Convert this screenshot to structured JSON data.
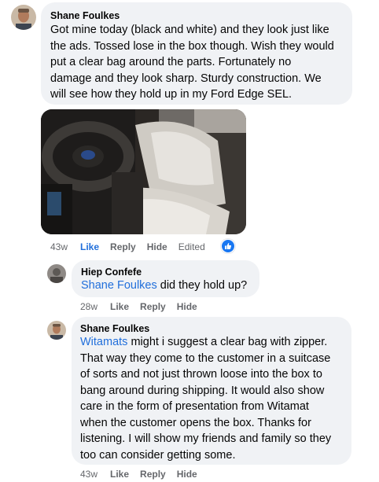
{
  "comments": [
    {
      "author": "Shane Foulkes",
      "lines": [
        "Got mine today (black and white) and they look just like",
        "the ads. Tossed lose in the box though. Wish they would",
        "put a clear bag around the parts. Fortunately no",
        "damage and they look sharp. Sturdy construction. We",
        "will see how they hold up in my Ford Edge SEL."
      ],
      "time": "43w",
      "like": "Like",
      "reply": "Reply",
      "hide": "Hide",
      "edited": "Edited",
      "reaction": "like-reaction-icon"
    },
    {
      "author": "Hiep Confefe",
      "mention": "Shane Foulkes",
      "text": " did they hold up?",
      "time": "28w",
      "like": "Like",
      "reply": "Reply",
      "hide": "Hide"
    },
    {
      "author": "Shane Foulkes",
      "mention": "Witamats",
      "first_line_rest": " might i suggest a clear bag with zipper.",
      "lines": [
        "That way they come to the customer in a suitcase",
        "of sorts and not just thrown loose into the box to",
        "bang around during shipping. It would also show",
        "care in the form of presentation from Witamat",
        "when the customer opens the box. Thanks for",
        "listening. I will show my friends and family so they",
        "too can consider getting some."
      ],
      "time": "43w",
      "like": "Like",
      "reply": "Reply",
      "hide": "Hide"
    }
  ],
  "colors": {
    "bubble": "#f0f2f5",
    "link": "#216fdb",
    "meta": "#65676b",
    "reaction": "#1877f2"
  }
}
